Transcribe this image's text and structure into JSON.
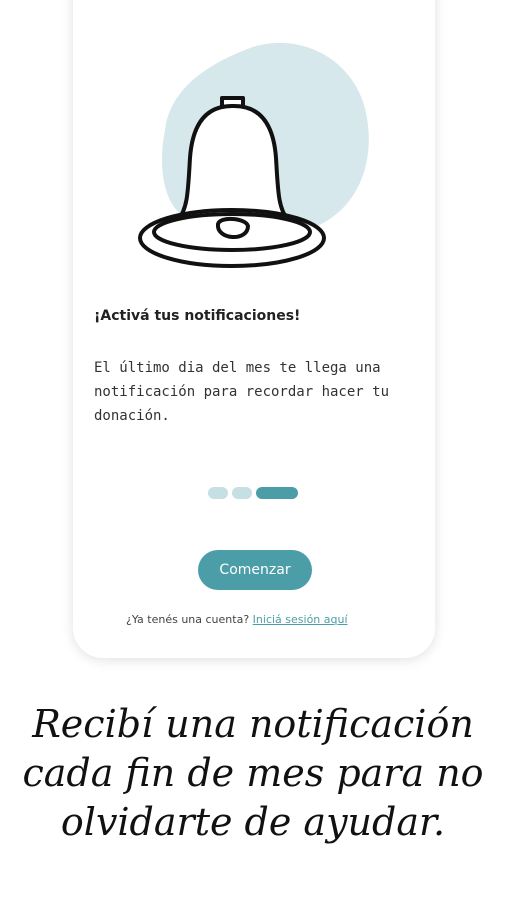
{
  "onboarding": {
    "title": "¡Activá tus notificaciones!",
    "description": "El último dia del mes te llega una notificación para recordar hacer tu donación.",
    "pager": {
      "total": 3,
      "active_index": 2
    },
    "start_button": "Comenzar",
    "signin_prompt": "¿Ya tenés una cuenta?",
    "signin_link": "Iniciá sesión aquí"
  },
  "caption": {
    "text": "Recibí una notificación cada fin de mes para no olvidarte de ayudar."
  },
  "colors": {
    "accent": "#4b9ea8",
    "dot_inactive": "#c6dfe3",
    "blob": "#d6e8ec"
  },
  "icons": {
    "illustration": "bell-icon"
  }
}
